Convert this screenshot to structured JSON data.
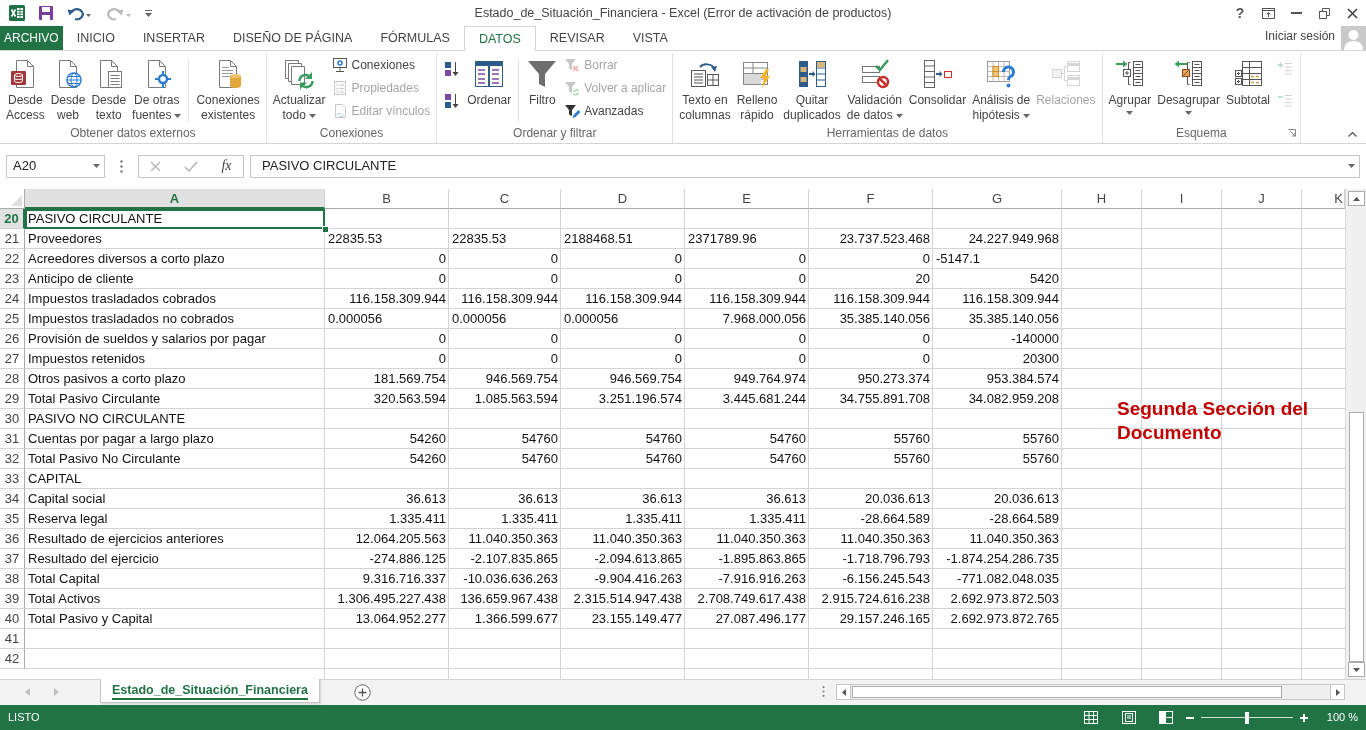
{
  "window": {
    "title": "Estado_de_Situación_Financiera - Excel (Error de activación de productos)",
    "help": "?"
  },
  "ribbon": {
    "tabs": [
      {
        "label": "ARCHIVO",
        "kind": "file",
        "selected": false
      },
      {
        "label": "INICIO",
        "kind": "tab",
        "selected": false
      },
      {
        "label": "INSERTAR",
        "kind": "tab",
        "selected": false
      },
      {
        "label": "DISEÑO DE PÁGINA",
        "kind": "tab",
        "selected": false
      },
      {
        "label": "FÓRMULAS",
        "kind": "tab",
        "selected": false
      },
      {
        "label": "DATOS",
        "kind": "tab",
        "selected": true
      },
      {
        "label": "REVISAR",
        "kind": "tab",
        "selected": false
      },
      {
        "label": "VISTA",
        "kind": "tab",
        "selected": false
      }
    ],
    "account": "Iniciar sesión",
    "groups": [
      {
        "label": "Obtener datos externos",
        "launcher": false,
        "commands": [
          {
            "label": "Desde\nAccess",
            "kind": "large",
            "dropdown": false,
            "disabled": false
          },
          {
            "label": "Desde\nweb",
            "kind": "large",
            "dropdown": false,
            "disabled": false
          },
          {
            "label": "Desde\ntexto",
            "kind": "large",
            "dropdown": false,
            "disabled": false
          },
          {
            "label": "De otras\nfuentes",
            "kind": "large",
            "dropdown": true,
            "disabled": false
          },
          {
            "kind": "separator"
          },
          {
            "label": "Conexiones\nexistentes",
            "kind": "large",
            "dropdown": false,
            "disabled": false
          }
        ]
      },
      {
        "label": "Conexiones",
        "launcher": false,
        "commands": [
          {
            "label": "Actualizar\ntodo",
            "kind": "large",
            "dropdown": true,
            "disabled": false
          },
          {
            "label": "Conexiones",
            "kind": "small",
            "dropdown": false,
            "disabled": false
          },
          {
            "label": "Propiedades",
            "kind": "small",
            "dropdown": false,
            "disabled": true
          },
          {
            "label": "Editar vínculos",
            "kind": "small",
            "dropdown": false,
            "disabled": true
          }
        ]
      },
      {
        "label": "Ordenar y filtrar",
        "launcher": false,
        "commands": [
          {
            "kind": "icon",
            "dropdown": false,
            "disabled": false
          },
          {
            "kind": "icon",
            "dropdown": false,
            "disabled": false
          },
          {
            "label": "Ordenar",
            "kind": "large",
            "dropdown": false,
            "disabled": false
          },
          {
            "kind": "separator"
          },
          {
            "label": "Filtro",
            "kind": "large",
            "dropdown": false,
            "disabled": false
          },
          {
            "label": "Borrar",
            "kind": "small",
            "dropdown": false,
            "disabled": true
          },
          {
            "label": "Volver a aplicar",
            "kind": "small",
            "dropdown": false,
            "disabled": true
          },
          {
            "label": "Avanzadas",
            "kind": "small",
            "dropdown": false,
            "disabled": false
          }
        ]
      },
      {
        "label": "Herramientas de datos",
        "launcher": false,
        "commands": [
          {
            "label": "Texto en\ncolumnas",
            "kind": "large",
            "dropdown": false,
            "disabled": false
          },
          {
            "label": "Relleno\nrápido",
            "kind": "large",
            "dropdown": false,
            "disabled": false
          },
          {
            "label": "Quitar\nduplicados",
            "kind": "large",
            "dropdown": false,
            "disabled": false
          },
          {
            "label": "Validación\nde datos",
            "kind": "large",
            "dropdown": true,
            "disabled": false
          },
          {
            "label": "Consolidar",
            "kind": "large",
            "dropdown": false,
            "disabled": false
          },
          {
            "label": "Análisis de\nhipótesis",
            "kind": "large",
            "dropdown": true,
            "disabled": false
          },
          {
            "label": "Relaciones",
            "kind": "large",
            "dropdown": false,
            "disabled": true
          }
        ]
      },
      {
        "label": "Esquema",
        "launcher": true,
        "commands": [
          {
            "label": "Agrupar",
            "kind": "large",
            "dropdown": true,
            "disabled": false
          },
          {
            "label": "Desagrupar",
            "kind": "large",
            "dropdown": true,
            "disabled": false
          },
          {
            "label": "Subtotal",
            "kind": "large",
            "dropdown": false,
            "disabled": false
          },
          {
            "kind": "icon",
            "dropdown": false,
            "disabled": true
          },
          {
            "kind": "icon",
            "dropdown": false,
            "disabled": true
          }
        ]
      }
    ]
  },
  "formula_bar": {
    "name_box": "A20",
    "function_button": "fx",
    "formula": "PASIVO CIRCULANTE"
  },
  "sheet": {
    "columns": [
      {
        "label": "A",
        "selected": true
      },
      {
        "label": "B",
        "selected": false
      },
      {
        "label": "C",
        "selected": false
      },
      {
        "label": "D",
        "selected": false
      },
      {
        "label": "E",
        "selected": false
      },
      {
        "label": "F",
        "selected": false
      },
      {
        "label": "G",
        "selected": false
      },
      {
        "label": "H",
        "selected": false
      },
      {
        "label": "I",
        "selected": false
      },
      {
        "label": "J",
        "selected": false
      },
      {
        "label": "K",
        "selected": false
      }
    ],
    "rows": [
      {
        "label": "20",
        "selected": true,
        "cells": [
          {
            "text": "PASIVO CIRCULANTE",
            "kind": "text"
          }
        ]
      },
      {
        "label": "21",
        "selected": false,
        "cells": [
          {
            "text": "Proveedores",
            "kind": "text"
          },
          {
            "text": "22835.53",
            "kind": "text"
          },
          {
            "text": "22835.53",
            "kind": "text"
          },
          {
            "text": "2188468.51",
            "kind": "text"
          },
          {
            "text": "2371789.96",
            "kind": "text"
          },
          {
            "text": "23.737.523.468",
            "kind": "number"
          },
          {
            "text": "24.227.949.968",
            "kind": "number"
          }
        ]
      },
      {
        "label": "22",
        "selected": false,
        "cells": [
          {
            "text": "Acreedores diversos a corto plazo",
            "kind": "text"
          },
          {
            "text": "0",
            "kind": "number"
          },
          {
            "text": "0",
            "kind": "number"
          },
          {
            "text": "0",
            "kind": "number"
          },
          {
            "text": "0",
            "kind": "number"
          },
          {
            "text": "0",
            "kind": "number"
          },
          {
            "text": "-5147.1",
            "kind": "text"
          }
        ]
      },
      {
        "label": "23",
        "selected": false,
        "cells": [
          {
            "text": "Anticipo de cliente",
            "kind": "text"
          },
          {
            "text": "0",
            "kind": "number"
          },
          {
            "text": "0",
            "kind": "number"
          },
          {
            "text": "0",
            "kind": "number"
          },
          {
            "text": "0",
            "kind": "number"
          },
          {
            "text": "20",
            "kind": "number"
          },
          {
            "text": "5420",
            "kind": "number"
          }
        ]
      },
      {
        "label": "24",
        "selected": false,
        "cells": [
          {
            "text": "Impuestos trasladados cobrados",
            "kind": "text"
          },
          {
            "text": "116.158.309.944",
            "kind": "number"
          },
          {
            "text": "116.158.309.944",
            "kind": "number"
          },
          {
            "text": "116.158.309.944",
            "kind": "number"
          },
          {
            "text": "116.158.309.944",
            "kind": "number"
          },
          {
            "text": "116.158.309.944",
            "kind": "number"
          },
          {
            "text": "116.158.309.944",
            "kind": "number"
          }
        ]
      },
      {
        "label": "25",
        "selected": false,
        "cells": [
          {
            "text": "Impuestos trasladados no cobrados",
            "kind": "text"
          },
          {
            "text": "0.000056",
            "kind": "text"
          },
          {
            "text": "0.000056",
            "kind": "text"
          },
          {
            "text": "0.000056",
            "kind": "text"
          },
          {
            "text": "7.968.000.056",
            "kind": "number"
          },
          {
            "text": "35.385.140.056",
            "kind": "number"
          },
          {
            "text": "35.385.140.056",
            "kind": "number"
          }
        ]
      },
      {
        "label": "26",
        "selected": false,
        "cells": [
          {
            "text": "Provisión de sueldos y salarios por pagar",
            "kind": "text"
          },
          {
            "text": "0",
            "kind": "number"
          },
          {
            "text": "0",
            "kind": "number"
          },
          {
            "text": "0",
            "kind": "number"
          },
          {
            "text": "0",
            "kind": "number"
          },
          {
            "text": "0",
            "kind": "number"
          },
          {
            "text": "-140000",
            "kind": "number"
          }
        ]
      },
      {
        "label": "27",
        "selected": false,
        "cells": [
          {
            "text": "Impuestos retenidos",
            "kind": "text"
          },
          {
            "text": "0",
            "kind": "number"
          },
          {
            "text": "0",
            "kind": "number"
          },
          {
            "text": "0",
            "kind": "number"
          },
          {
            "text": "0",
            "kind": "number"
          },
          {
            "text": "0",
            "kind": "number"
          },
          {
            "text": "20300",
            "kind": "number"
          }
        ]
      },
      {
        "label": "28",
        "selected": false,
        "cells": [
          {
            "text": "Otros pasivos a corto plazo",
            "kind": "text"
          },
          {
            "text": "181.569.754",
            "kind": "number"
          },
          {
            "text": "946.569.754",
            "kind": "number"
          },
          {
            "text": "946.569.754",
            "kind": "number"
          },
          {
            "text": "949.764.974",
            "kind": "number"
          },
          {
            "text": "950.273.374",
            "kind": "number"
          },
          {
            "text": "953.384.574",
            "kind": "number"
          }
        ]
      },
      {
        "label": "29",
        "selected": false,
        "cells": [
          {
            "text": "Total Pasivo Circulante",
            "kind": "text"
          },
          {
            "text": "320.563.594",
            "kind": "number"
          },
          {
            "text": "1.085.563.594",
            "kind": "number"
          },
          {
            "text": "3.251.196.574",
            "kind": "number"
          },
          {
            "text": "3.445.681.244",
            "kind": "number"
          },
          {
            "text": "34.755.891.708",
            "kind": "number"
          },
          {
            "text": "34.082.959.208",
            "kind": "number"
          }
        ]
      },
      {
        "label": "30",
        "selected": false,
        "cells": [
          {
            "text": "PASIVO NO CIRCULANTE",
            "kind": "text"
          }
        ]
      },
      {
        "label": "31",
        "selected": false,
        "cells": [
          {
            "text": "Cuentas por pagar a largo plazo",
            "kind": "text"
          },
          {
            "text": "54260",
            "kind": "number"
          },
          {
            "text": "54760",
            "kind": "number"
          },
          {
            "text": "54760",
            "kind": "number"
          },
          {
            "text": "54760",
            "kind": "number"
          },
          {
            "text": "55760",
            "kind": "number"
          },
          {
            "text": "55760",
            "kind": "number"
          }
        ]
      },
      {
        "label": "32",
        "selected": false,
        "cells": [
          {
            "text": "Total Pasivo No Circulante",
            "kind": "text"
          },
          {
            "text": "54260",
            "kind": "number"
          },
          {
            "text": "54760",
            "kind": "number"
          },
          {
            "text": "54760",
            "kind": "number"
          },
          {
            "text": "54760",
            "kind": "number"
          },
          {
            "text": "55760",
            "kind": "number"
          },
          {
            "text": "55760",
            "kind": "number"
          }
        ]
      },
      {
        "label": "33",
        "selected": false,
        "cells": [
          {
            "text": "CAPITAL",
            "kind": "text"
          }
        ]
      },
      {
        "label": "34",
        "selected": false,
        "cells": [
          {
            "text": "Capital social",
            "kind": "text"
          },
          {
            "text": "36.613",
            "kind": "number"
          },
          {
            "text": "36.613",
            "kind": "number"
          },
          {
            "text": "36.613",
            "kind": "number"
          },
          {
            "text": "36.613",
            "kind": "number"
          },
          {
            "text": "20.036.613",
            "kind": "number"
          },
          {
            "text": "20.036.613",
            "kind": "number"
          }
        ]
      },
      {
        "label": "35",
        "selected": false,
        "cells": [
          {
            "text": "Reserva legal",
            "kind": "text"
          },
          {
            "text": "1.335.411",
            "kind": "number"
          },
          {
            "text": "1.335.411",
            "kind": "number"
          },
          {
            "text": "1.335.411",
            "kind": "number"
          },
          {
            "text": "1.335.411",
            "kind": "number"
          },
          {
            "text": "-28.664.589",
            "kind": "number"
          },
          {
            "text": "-28.664.589",
            "kind": "number"
          }
        ]
      },
      {
        "label": "36",
        "selected": false,
        "cells": [
          {
            "text": "Resultado de ejercicios anteriores",
            "kind": "text"
          },
          {
            "text": "12.064.205.563",
            "kind": "number"
          },
          {
            "text": "11.040.350.363",
            "kind": "number"
          },
          {
            "text": "11.040.350.363",
            "kind": "number"
          },
          {
            "text": "11.040.350.363",
            "kind": "number"
          },
          {
            "text": "11.040.350.363",
            "kind": "number"
          },
          {
            "text": "11.040.350.363",
            "kind": "number"
          }
        ]
      },
      {
        "label": "37",
        "selected": false,
        "cells": [
          {
            "text": "Resultado del ejercicio",
            "kind": "text"
          },
          {
            "text": "-274.886.125",
            "kind": "number"
          },
          {
            "text": "-2.107.835.865",
            "kind": "number"
          },
          {
            "text": "-2.094.613.865",
            "kind": "number"
          },
          {
            "text": "-1.895.863.865",
            "kind": "number"
          },
          {
            "text": "-1.718.796.793",
            "kind": "number"
          },
          {
            "text": "-1.874.254.286.735",
            "kind": "number"
          }
        ]
      },
      {
        "label": "38",
        "selected": false,
        "cells": [
          {
            "text": "Total Capital",
            "kind": "text"
          },
          {
            "text": "9.316.716.337",
            "kind": "number"
          },
          {
            "text": "-10.036.636.263",
            "kind": "number"
          },
          {
            "text": "-9.904.416.263",
            "kind": "number"
          },
          {
            "text": "-7.916.916.263",
            "kind": "number"
          },
          {
            "text": "-6.156.245.543",
            "kind": "number"
          },
          {
            "text": "-771.082.048.035",
            "kind": "number"
          }
        ]
      },
      {
        "label": "39",
        "selected": false,
        "cells": [
          {
            "text": "Total Activos",
            "kind": "text"
          },
          {
            "text": "1.306.495.227.438",
            "kind": "number"
          },
          {
            "text": "136.659.967.438",
            "kind": "number"
          },
          {
            "text": "2.315.514.947.438",
            "kind": "number"
          },
          {
            "text": "2.708.749.617.438",
            "kind": "number"
          },
          {
            "text": "2.915.724.616.238",
            "kind": "number"
          },
          {
            "text": "2.692.973.872.503",
            "kind": "number"
          }
        ]
      },
      {
        "label": "40",
        "selected": false,
        "cells": [
          {
            "text": "Total Pasivo y Capital",
            "kind": "text"
          },
          {
            "text": "13.064.952.277",
            "kind": "number"
          },
          {
            "text": "1.366.599.677",
            "kind": "number"
          },
          {
            "text": "23.155.149.477",
            "kind": "number"
          },
          {
            "text": "27.087.496.177",
            "kind": "number"
          },
          {
            "text": "29.157.246.165",
            "kind": "number"
          },
          {
            "text": "2.692.973.872.765",
            "kind": "number"
          }
        ]
      },
      {
        "label": "41",
        "selected": false
      },
      {
        "label": "42",
        "selected": false
      }
    ],
    "note": "Segunda Sección del Documento"
  },
  "sheet_tabs": [
    {
      "label": "Estado_de_Situación_Financiera",
      "selected": true
    }
  ],
  "status_bar": {
    "mode": "LISTO",
    "zoom": {
      "level": 0.5,
      "reading": "100 %"
    }
  }
}
